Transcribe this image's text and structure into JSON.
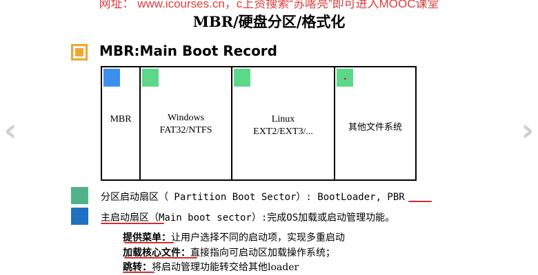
{
  "watermark": "网址： www.icourses.cn，c上资搜索“苏喀亮”即可进入MOOC课堂",
  "slide_title": "MBR/硬盘分区/格式化",
  "section_heading": "MBR:Main Boot Record",
  "partitions": [
    {
      "line1": "MBR",
      "line2": ""
    },
    {
      "line1": "Windows",
      "line2": "FAT32/NTFS"
    },
    {
      "line1": "Linux",
      "line2": "EXT2/EXT3/..."
    },
    {
      "line1": "其他文件系统",
      "line2": ""
    }
  ],
  "legend": [
    {
      "color": "#4fb28a",
      "text": "分区启动扇区（ Partition Boot Sector）: BootLoader, PBR"
    },
    {
      "color": "#1f6fc2",
      "text": "主启动扇区（Main boot sector）:完成OS加载或启动管理功能。"
    }
  ],
  "features": [
    {
      "title": "提供菜单：",
      "desc": "让用户选择不同的启动项，实现多重启动"
    },
    {
      "title": "加载核心文件：",
      "desc": "直接指向可启动区加载操作系统；"
    },
    {
      "title": "跳转：",
      "desc": "将启动管理功能转交给其他loader"
    }
  ],
  "colors": {
    "accent_orange": "#f1a531",
    "mark_blue": "#3d8fee",
    "mark_green": "#5cd88a",
    "annotation_red": "#d82a2a"
  },
  "icons": {
    "nav_left": "‹",
    "nav_right": "›"
  }
}
